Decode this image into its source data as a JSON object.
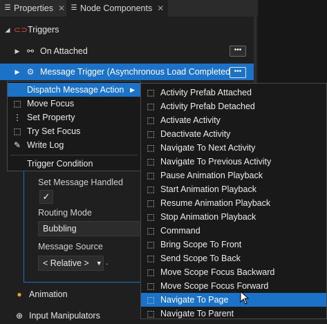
{
  "tabs": {
    "properties": "Properties",
    "node_components": "Node Components"
  },
  "panel": {
    "triggers_label": "Triggers",
    "on_attached_label": "On Attached",
    "message_trigger_label": "Message Trigger (Asynchronous Load Completed)",
    "dots_label": "•••",
    "set_message_handled_label": "Set Message Handled",
    "set_message_handled_value": "✓",
    "routing_mode_label": "Routing Mode",
    "routing_mode_value": "Bubbling",
    "message_source_label": "Message Source",
    "message_source_value": "< Relative >",
    "message_source_suffix": ".",
    "animation_label": "Animation",
    "input_manipulators_label": "Input Manipulators"
  },
  "context_menu": {
    "items": [
      {
        "label": "Dispatch Message Action",
        "submenu_arrow": "▶"
      },
      {
        "label": "Move Focus"
      },
      {
        "label": "Set Property"
      },
      {
        "label": "Try Set Focus"
      },
      {
        "label": "Write Log"
      },
      {
        "label": "Trigger Condition"
      }
    ]
  },
  "submenu": {
    "items": [
      "Activity Prefab Attached",
      "Activity Prefab Detached",
      "Activate Activity",
      "Deactivate Activity",
      "Navigate To Next Activity",
      "Navigate To Previous Activity",
      "Pause Animation Playback",
      "Start Animation Playback",
      "Resume Animation Playback",
      "Stop Animation Playback",
      "Command",
      "Bring Scope To Front",
      "Send Scope To Back",
      "Move Scope Focus Backward",
      "Move Scope Focus Forward",
      "Navigate To Page",
      "Navigate To Parent"
    ],
    "highlighted": "Navigate To Page"
  },
  "colors": {
    "accent": "#1c72c7",
    "background": "#1f1f1f",
    "menu_background": "#191919"
  }
}
